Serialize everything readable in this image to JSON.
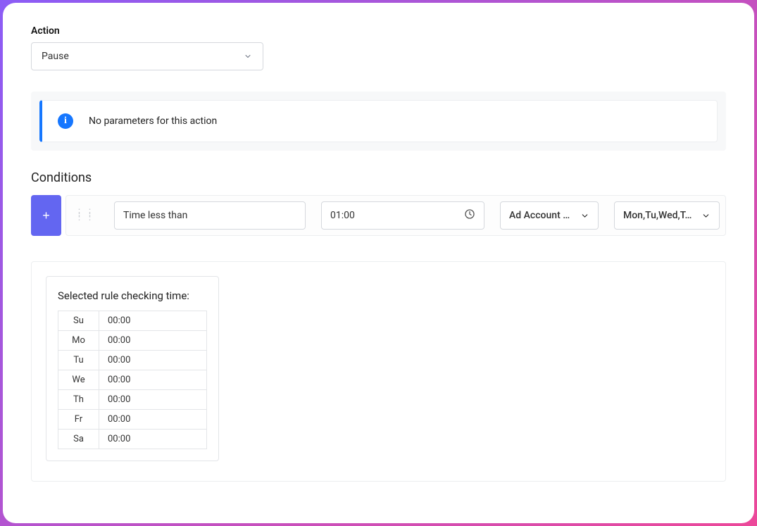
{
  "action": {
    "label": "Action",
    "value": "Pause"
  },
  "info": {
    "text": "No parameters for this action"
  },
  "conditions": {
    "title": "Conditions",
    "add_label": "+",
    "metric": "Time less than",
    "time_value": "01:00",
    "tz": "Ad Account …",
    "days": "Mon,Tu,Wed,T…"
  },
  "schedule": {
    "title": "Selected rule checking time:",
    "rows": [
      {
        "day": "Su",
        "time": "00:00"
      },
      {
        "day": "Mo",
        "time": "00:00"
      },
      {
        "day": "Tu",
        "time": "00:00"
      },
      {
        "day": "We",
        "time": "00:00"
      },
      {
        "day": "Th",
        "time": "00:00"
      },
      {
        "day": "Fr",
        "time": "00:00"
      },
      {
        "day": "Sa",
        "time": "00:00"
      }
    ]
  }
}
